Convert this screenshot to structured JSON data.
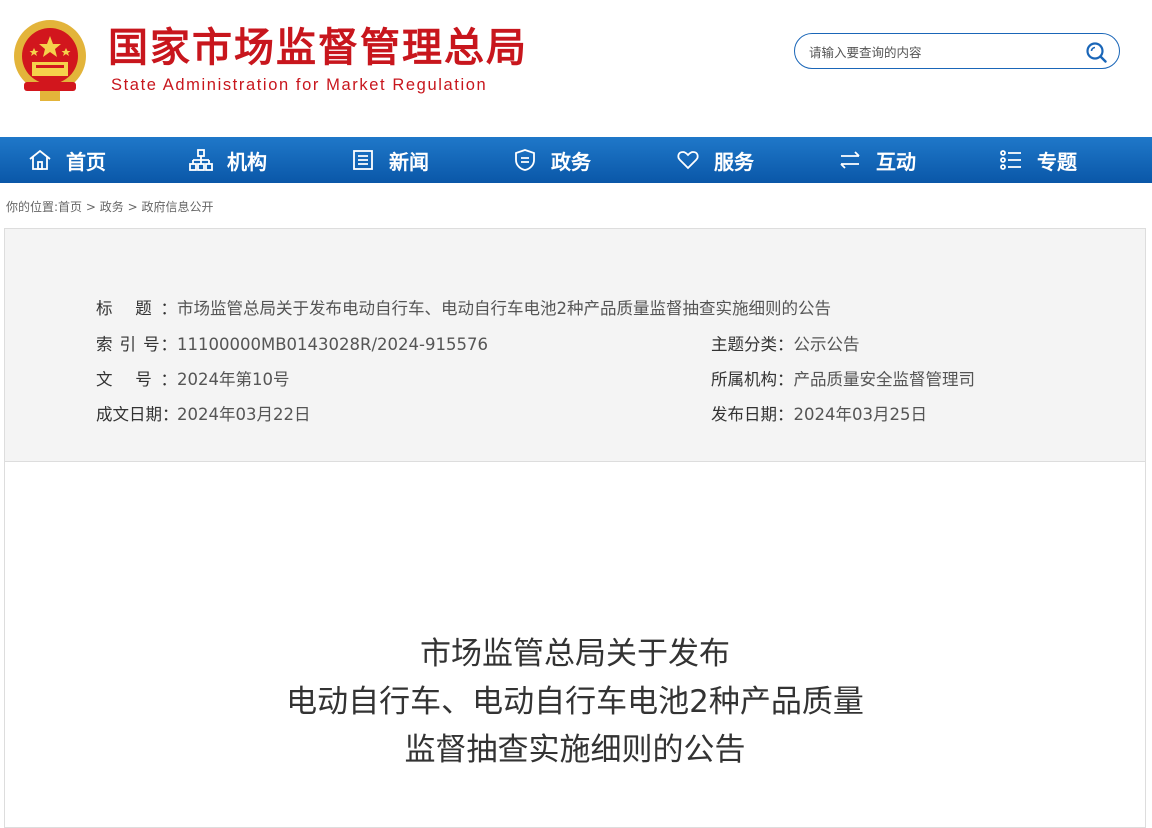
{
  "header": {
    "org_name_cn": "国家市场监督管理总局",
    "org_name_en": "State Administration for Market Regulation",
    "search": {
      "placeholder": "请输入要查询的内容"
    }
  },
  "nav": {
    "items": [
      {
        "label": "首页",
        "icon": "home-icon"
      },
      {
        "label": "机构",
        "icon": "org-chart-icon"
      },
      {
        "label": "新闻",
        "icon": "news-icon"
      },
      {
        "label": "政务",
        "icon": "shield-icon"
      },
      {
        "label": "服务",
        "icon": "heart-icon"
      },
      {
        "label": "互动",
        "icon": "exchange-icon"
      },
      {
        "label": "专题",
        "icon": "list-icon"
      }
    ]
  },
  "breadcrumb": {
    "prefix": "你的位置:",
    "items": [
      "首页",
      "政务",
      "政府信息公开"
    ],
    "separator": ">"
  },
  "meta": {
    "title_label": "标 题：",
    "title_value": "市场监管总局关于发布电动自行车、电动自行车电池2种产品质量监督抽查实施细则的公告",
    "index_label": "索 引 号：",
    "index_value": "11100000MB0143028R/2024-915576",
    "topic_label": "主题分类：",
    "topic_value": "公示公告",
    "docno_label": "文 号：",
    "docno_value": "2024年第10号",
    "dept_label": "所属机构：",
    "dept_value": "产品质量安全监督管理司",
    "written_label": "成文日期：",
    "written_value": "2024年03月22日",
    "published_label": "发布日期：",
    "published_value": "2024年03月25日"
  },
  "document": {
    "title_lines": [
      "市场监管总局关于发布",
      "电动自行车、电动自行车电池2种产品质量",
      "监督抽查实施细则的公告"
    ]
  },
  "colors": {
    "brand_red": "#c8161d",
    "nav_blue": "#0a57a8",
    "meta_bg": "#f4f4f4"
  }
}
